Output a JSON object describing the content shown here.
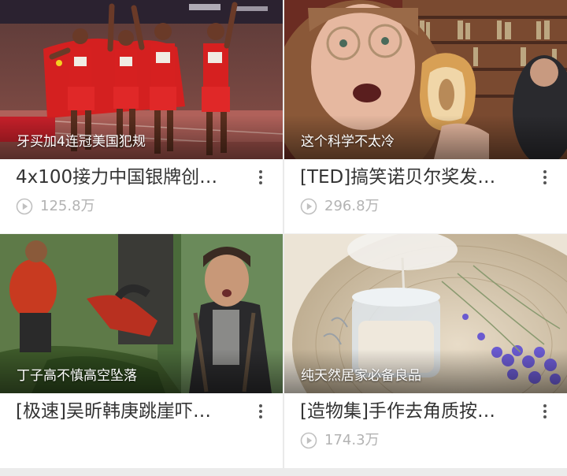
{
  "videos": [
    {
      "caption": "牙买加4连冠美国犯规",
      "title": "4x100接力中国银牌创…",
      "views": "125.8万"
    },
    {
      "caption": "这个科学不太冷",
      "title": "[TED]搞笑诺贝尔奖发…",
      "views": "296.8万"
    },
    {
      "caption": "丁子高不慎高空坠落",
      "title": "[极速]吴昕韩庚跳崖吓…",
      "views": ""
    },
    {
      "caption": "纯天然居家必备良品",
      "title": "[造物集]手作去角质按…",
      "views": "174.3万"
    }
  ],
  "icons": {
    "play": "play-circle-icon",
    "more": "more-vertical-icon"
  },
  "colors": {
    "title": "#333333",
    "views": "#b3b3b3",
    "caption": "#ffffff"
  }
}
